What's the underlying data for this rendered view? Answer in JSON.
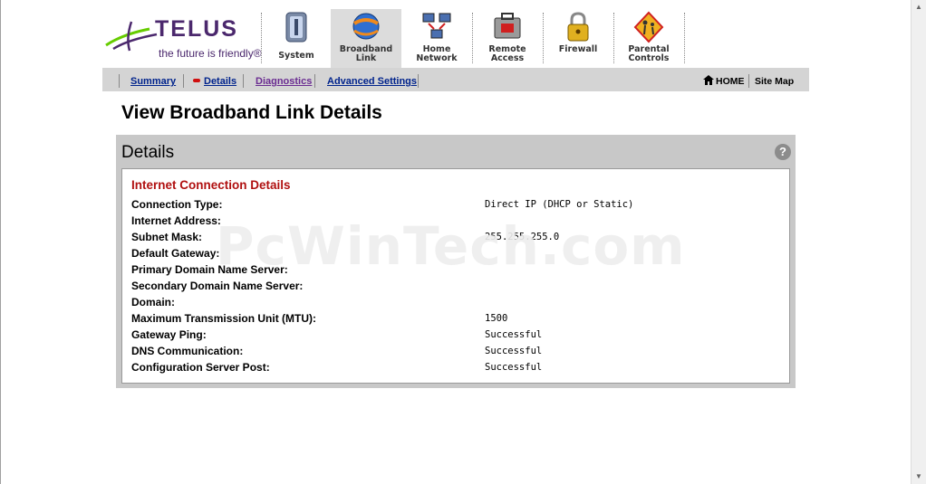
{
  "header": {
    "brand": "TELUS",
    "tagline": "the future is friendly®"
  },
  "nav": {
    "items": [
      {
        "label_line1": "System",
        "label_line2": "",
        "icon": "system-icon"
      },
      {
        "label_line1": "Broadband",
        "label_line2": "Link",
        "icon": "broadband-globe-icon"
      },
      {
        "label_line1": "Home",
        "label_line2": "Network",
        "icon": "network-computers-icon"
      },
      {
        "label_line1": "Remote",
        "label_line2": "Access",
        "icon": "remote-access-toolbox-icon"
      },
      {
        "label_line1": "Firewall",
        "label_line2": "",
        "icon": "padlock-icon"
      },
      {
        "label_line1": "Parental",
        "label_line2": "Controls",
        "icon": "parental-sign-icon"
      }
    ],
    "active": "Broadband Link"
  },
  "subnav": {
    "links": [
      "Summary",
      "Details",
      "Diagnostics",
      "Advanced Settings"
    ],
    "home": "HOME",
    "sitemap": "Site Map"
  },
  "page_title": "View Broadband Link Details",
  "panel": {
    "title": "Details",
    "help": "?",
    "section_title": "Internet Connection Details",
    "rows": [
      {
        "label": "Connection Type:",
        "value": "Direct IP (DHCP or Static)"
      },
      {
        "label": "Internet Address:",
        "value": ""
      },
      {
        "label": "Subnet Mask:",
        "value": "255.255.255.0"
      },
      {
        "label": "Default Gateway:",
        "value": ""
      },
      {
        "label": "Primary Domain Name Server:",
        "value": ""
      },
      {
        "label": "Secondary Domain Name Server:",
        "value": ""
      },
      {
        "label": "Domain:",
        "value": ""
      },
      {
        "label": "Maximum Transmission Unit (MTU):",
        "value": "1500"
      },
      {
        "label": "Gateway Ping:",
        "value": "Successful"
      },
      {
        "label": "DNS Communication:",
        "value": "Successful"
      },
      {
        "label": "Configuration Server Post:",
        "value": "Successful"
      }
    ]
  },
  "watermark": "PcWinTech.com",
  "colors": {
    "brand_purple": "#4b286d",
    "brand_green": "#66cc00",
    "link_blue": "#00238c",
    "section_red": "#b01010",
    "panel_gray": "#c8c8c8"
  }
}
